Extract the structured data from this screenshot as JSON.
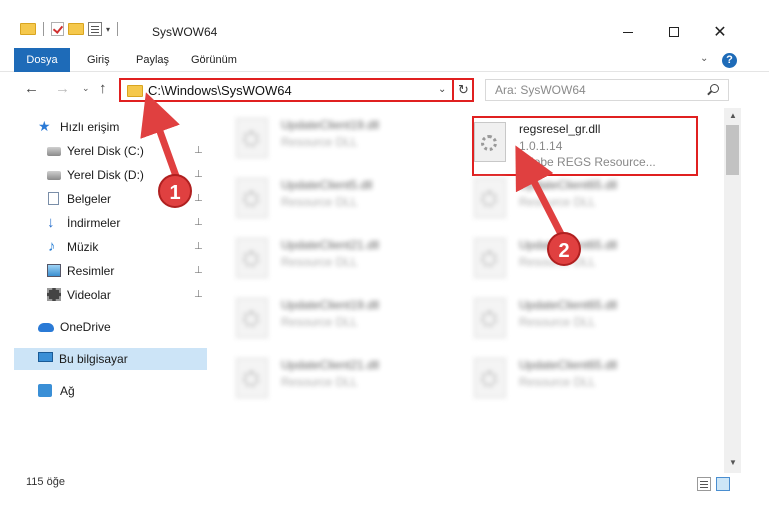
{
  "window": {
    "title": "SysWOW64",
    "minimize_icon": "minimize-icon",
    "maximize_icon": "maximize-icon",
    "close_icon": "close-icon",
    "close_glyph": "✕"
  },
  "quick_access": {
    "drop_glyph": "▾"
  },
  "ribbon": {
    "tabs": [
      {
        "label": "Dosya"
      },
      {
        "label": "Giriş"
      },
      {
        "label": "Paylaş"
      },
      {
        "label": "Görünüm"
      }
    ],
    "expand_glyph": "⌄",
    "help_glyph": "?"
  },
  "nav": {
    "back_glyph": "←",
    "forward_glyph": "→",
    "recent_glyph": "⌄",
    "up_glyph": "↑",
    "address": "C:\\Windows\\SysWOW64",
    "address_drop_glyph": "⌄",
    "refresh_glyph": "↻",
    "search_placeholder": "Ara: SysWOW64"
  },
  "sidebar": {
    "items": [
      {
        "label": "Hızlı erişim",
        "icon": "star-icon"
      },
      {
        "label": "Yerel Disk (C:)",
        "icon": "disk-icon",
        "pinned": true
      },
      {
        "label": "Yerel Disk (D:)",
        "icon": "disk-icon",
        "pinned": true
      },
      {
        "label": "Belgeler",
        "icon": "documents-icon",
        "pinned": true
      },
      {
        "label": "İndirmeler",
        "icon": "downloads-icon",
        "pinned": true
      },
      {
        "label": "Müzik",
        "icon": "music-icon",
        "pinned": true
      },
      {
        "label": "Resimler",
        "icon": "pictures-icon",
        "pinned": true
      },
      {
        "label": "Videolar",
        "icon": "videos-icon",
        "pinned": true
      },
      {
        "label": "OneDrive",
        "icon": "onedrive-icon"
      },
      {
        "label": "Bu bilgisayar",
        "icon": "computer-icon",
        "selected": true
      },
      {
        "label": "Ağ",
        "icon": "network-icon"
      }
    ],
    "pin_glyph": "📌"
  },
  "files": {
    "highlighted": {
      "name": "regsresel_gr.dll",
      "version": "1.0.1.14",
      "description": "Adobe REGS Resource..."
    },
    "blurred": [
      {
        "name": "UpdateClient19.dll",
        "type": "Resource DLL"
      },
      {
        "name": "UpdateClient5.dll",
        "type": "Resource DLL"
      },
      {
        "name": "UpdateClient65.dll",
        "type": "Resource DLL"
      },
      {
        "name": "UpdateClient21.dll",
        "type": "Resource DLL"
      },
      {
        "name": "UpdateClient65.dll",
        "type": "Resource DLL"
      },
      {
        "name": "UpdateClient19.dll",
        "type": "Resource DLL"
      },
      {
        "name": "UpdateClient65.dll",
        "type": "Resource DLL"
      },
      {
        "name": "UpdateClient21.dll",
        "type": "Resource DLL"
      },
      {
        "name": "UpdateClient65.dll",
        "type": "Resource DLL"
      }
    ]
  },
  "scrollbar": {
    "up_glyph": "▲",
    "down_glyph": "▼"
  },
  "status": {
    "count": "115 öğe"
  },
  "annotations": {
    "step1": "1",
    "step2": "2",
    "color": "#e04040"
  }
}
